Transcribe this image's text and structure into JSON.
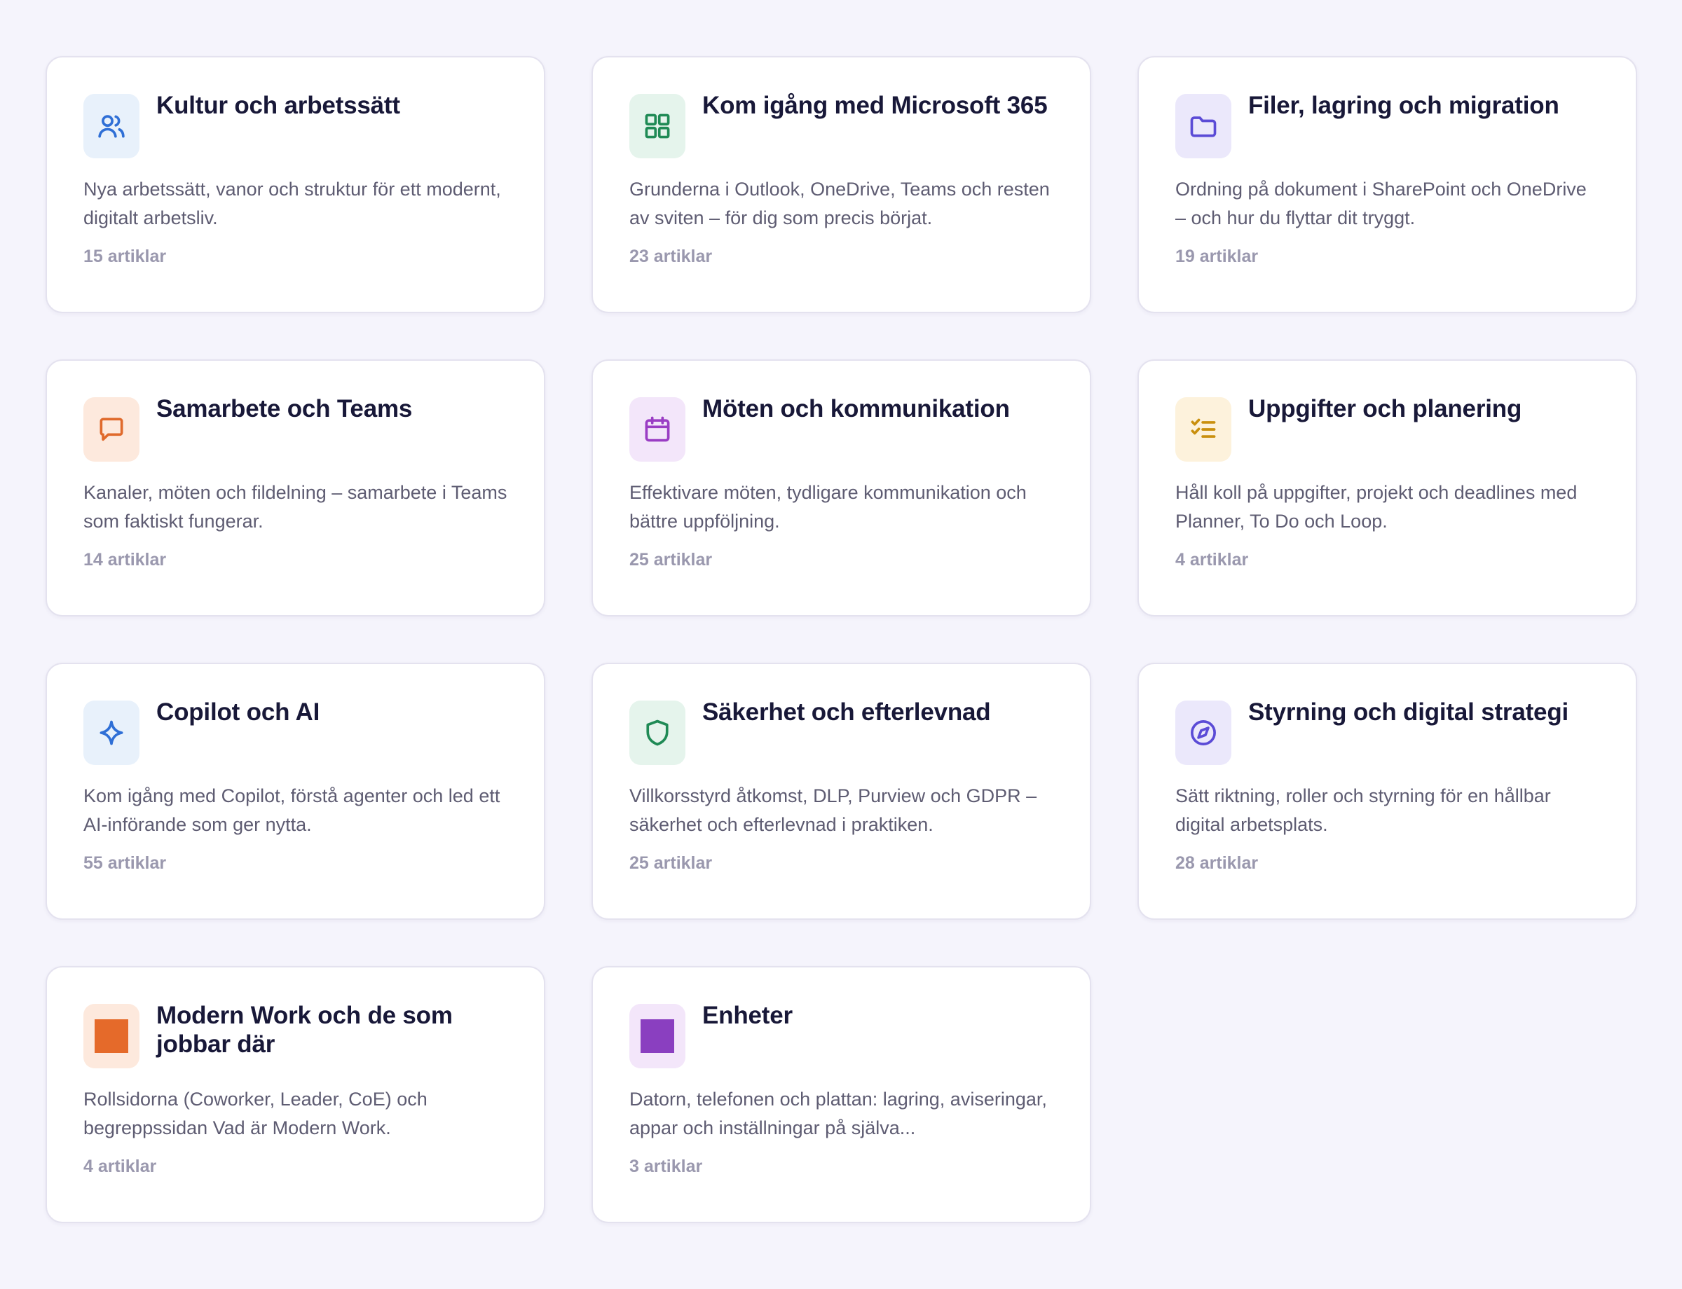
{
  "colors": {
    "page_background": "#f5f4fc",
    "card_background": "#ffffff",
    "title": "#181838",
    "description": "#5e5c72",
    "count": "#9a98ae"
  },
  "cards": [
    {
      "title": "Kultur och arbetssätt",
      "description": "Nya arbetssätt, vanor och struktur för ett modernt, digitalt arbetsliv.",
      "count": "15 artiklar",
      "icon": "users-icon",
      "icon_color": "#2f6fd6",
      "icon_bg": "#e8f1fb"
    },
    {
      "title": "Kom igång med Microsoft 365",
      "description": "Grunderna i Outlook, OneDrive, Teams och resten av sviten – för dig som precis börjat.",
      "count": "23 artiklar",
      "icon": "grid-icon",
      "icon_color": "#1f8a55",
      "icon_bg": "#e5f4ec"
    },
    {
      "title": "Filer, lagring och migration",
      "description": "Ordning på dokument i SharePoint och OneDrive – och hur du flyttar dit tryggt.",
      "count": "19 artiklar",
      "icon": "folder-icon",
      "icon_color": "#5b4bd6",
      "icon_bg": "#ebe8fb"
    },
    {
      "title": "Samarbete och Teams",
      "description": "Kanaler, möten och fildelning – samarbete i Teams som faktiskt fungerar.",
      "count": "14 artiklar",
      "icon": "chat-bubble-icon",
      "icon_color": "#e06a2c",
      "icon_bg": "#fde9dd"
    },
    {
      "title": "Möten och kommunikation",
      "description": "Effektivare möten, tydligare kommunikation och bättre uppföljning.",
      "count": "25 artiklar",
      "icon": "calendar-icon",
      "icon_color": "#9a3dc4",
      "icon_bg": "#f3e6fa"
    },
    {
      "title": "Uppgifter och planering",
      "description": "Håll koll på uppgifter, projekt och deadlines med Planner, To Do och Loop.",
      "count": "4 artiklar",
      "icon": "checklist-icon",
      "icon_color": "#c9900e",
      "icon_bg": "#fdf2dc"
    },
    {
      "title": "Copilot och AI",
      "description": "Kom igång med Copilot, förstå agenter och led ett AI-införande som ger nytta.",
      "count": "55 artiklar",
      "icon": "sparkle-icon",
      "icon_color": "#2f6fd6",
      "icon_bg": "#e8f1fb"
    },
    {
      "title": "Säkerhet och efterlevnad",
      "description": "Villkorsstyrd åtkomst, DLP, Purview och GDPR – säkerhet och efterlevnad i praktiken.",
      "count": "25 artiklar",
      "icon": "shield-icon",
      "icon_color": "#1f8a55",
      "icon_bg": "#e5f4ec"
    },
    {
      "title": "Styrning och digital strategi",
      "description": "Sätt riktning, roller och styrning för en hållbar digital arbetsplats.",
      "count": "28 artiklar",
      "icon": "compass-icon",
      "icon_color": "#5b4bd6",
      "icon_bg": "#ebe8fb"
    },
    {
      "title": "Modern Work och de som jobbar där",
      "description": "Rollsidorna (Coworker, Leader, CoE) och begreppssidan Vad är Modern Work.",
      "count": "4 artiklar",
      "icon": "orange-square-icon",
      "icon_color": "#e56a2a",
      "icon_bg": "#fde9dd"
    },
    {
      "title": "Enheter",
      "description": "Datorn, telefonen och plattan: lagring, aviseringar, appar och inställningar på självа...",
      "count": "3 artiklar",
      "icon": "purple-square-icon",
      "icon_color": "#8a3fc0",
      "icon_bg": "#f3e6fa"
    }
  ]
}
